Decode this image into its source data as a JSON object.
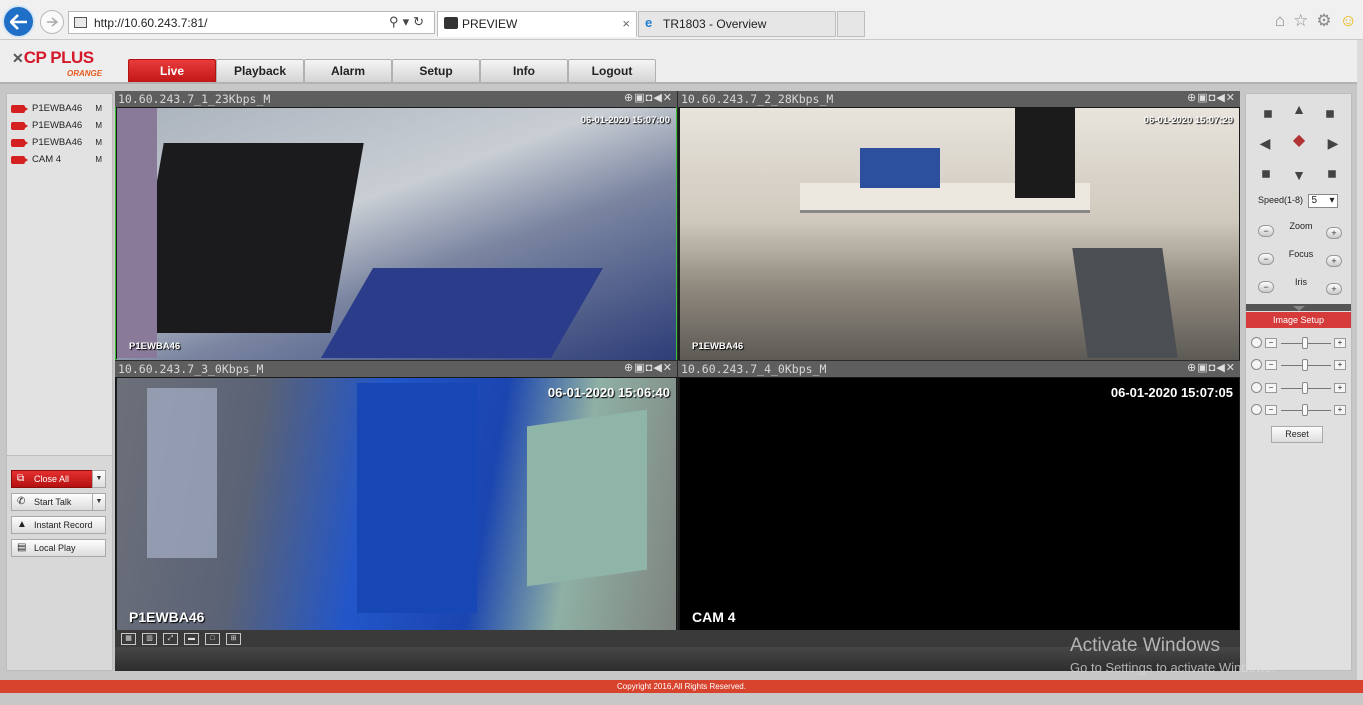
{
  "browser": {
    "url": "http://10.60.243.7:81/",
    "url_host": "10.60.243.7",
    "tabs": [
      {
        "label": "PREVIEW",
        "active": true
      },
      {
        "label": "TR1803 - Overview",
        "active": false
      }
    ],
    "close_glyph": "×"
  },
  "app": {
    "brand": "CP PLUS",
    "brand_sub": "ORANGE",
    "menu": [
      "Live",
      "Playback",
      "Alarm",
      "Setup",
      "Info",
      "Logout"
    ],
    "active_menu": "Live"
  },
  "devices": [
    {
      "name": "P1EWBA46",
      "stream": "M"
    },
    {
      "name": "P1EWBA46",
      "stream": "M"
    },
    {
      "name": "P1EWBA46",
      "stream": "M"
    },
    {
      "name": "CAM 4",
      "stream": "M"
    }
  ],
  "actions": {
    "close_all": "Close All",
    "start_talk": "Start Talk",
    "instant_record": "Instant Record",
    "local_play": "Local Play"
  },
  "tiles": [
    {
      "title": "10.60.243.7_1_23Kbps_M",
      "timestamp": "06-01-2020 15:07:00",
      "channel": "P1EWBA46"
    },
    {
      "title": "10.60.243.7_2_28Kbps_M",
      "timestamp": "06-01-2020 15:07:29",
      "channel": "P1EWBA46"
    },
    {
      "title": "10.60.243.7_3_0Kbps_M",
      "timestamp": "06-01-2020 15:06:40",
      "channel": "P1EWBA46"
    },
    {
      "title": "10.60.243.7_4_0Kbps_M",
      "timestamp": "06-01-2020 15:07:05",
      "channel": "CAM 4"
    }
  ],
  "ptz": {
    "speed_label": "Speed(1-8)",
    "speed_value": "5",
    "zoom": "Zoom",
    "focus": "Focus",
    "iris": "Iris",
    "image_setup": "Image Setup",
    "reset": "Reset"
  },
  "footer": {
    "copyright": "Copyright 2016,All Rights Reserved."
  },
  "watermark": {
    "line1": "Activate Windows",
    "line2": "Go to Settings to activate Windows."
  },
  "colors": {
    "accent_red": "#c31717",
    "footer_red": "#d8432e",
    "selected_tile_border": "#35c035"
  }
}
